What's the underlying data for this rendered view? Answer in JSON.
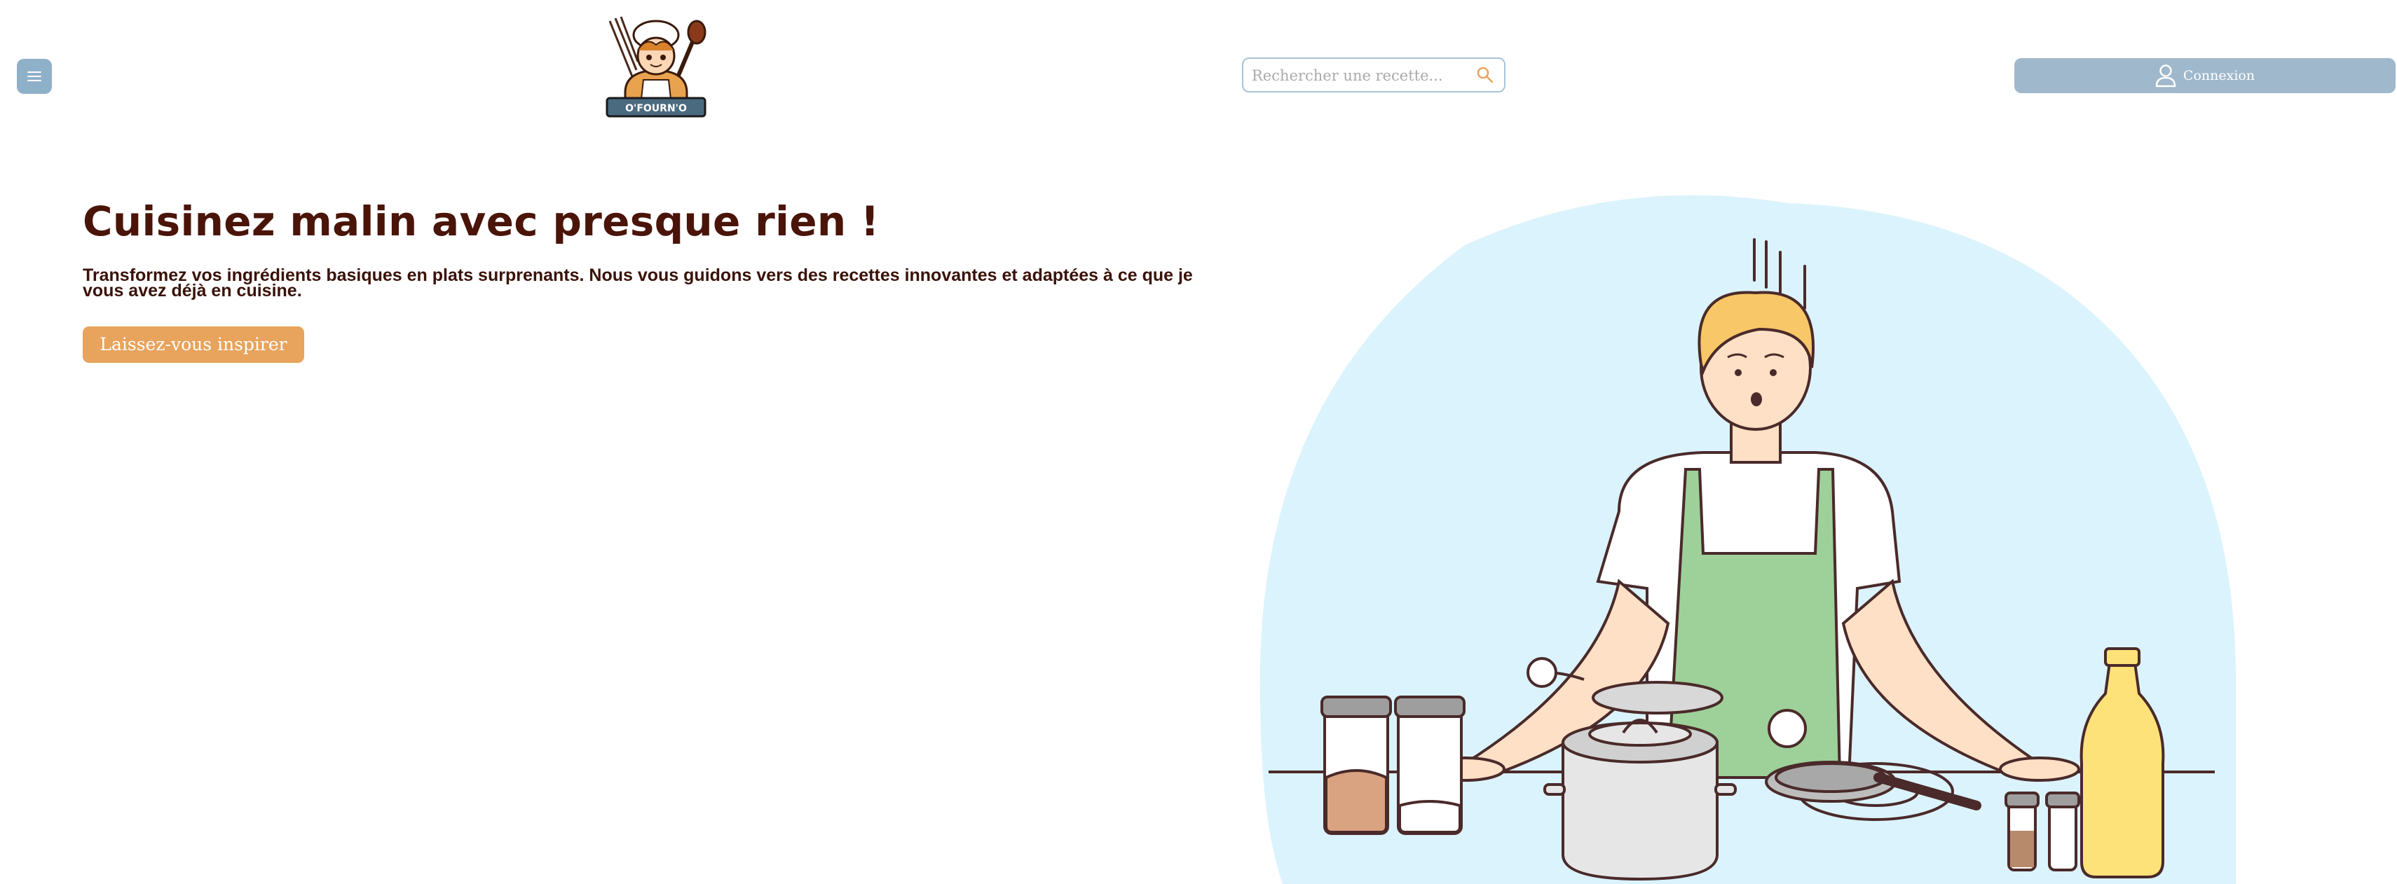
{
  "header": {
    "logo_text": "O'FOURN'O",
    "search": {
      "placeholder": "Rechercher une recette..."
    },
    "login_label": "Connexion"
  },
  "hero": {
    "title": "Cuisinez malin avec presque rien !",
    "subtitle": "Transformez vos ingrédients basiques en plats surprenants. Nous vous guidons vers des recettes innovantes et adaptées à ce que je vous avez déjà en cuisine.",
    "cta_label": "Laissez-vous inspirer"
  },
  "colors": {
    "title": "#4a1409",
    "cta": "#e8a35c",
    "menu_button": "#8fb0c9",
    "login_button": "#9fb8cc",
    "illustration_bg": "#dbf3fc",
    "apron": "#9ed09a"
  },
  "icons": {
    "menu": "hamburger-icon",
    "search": "search-icon",
    "login": "user-icon"
  }
}
